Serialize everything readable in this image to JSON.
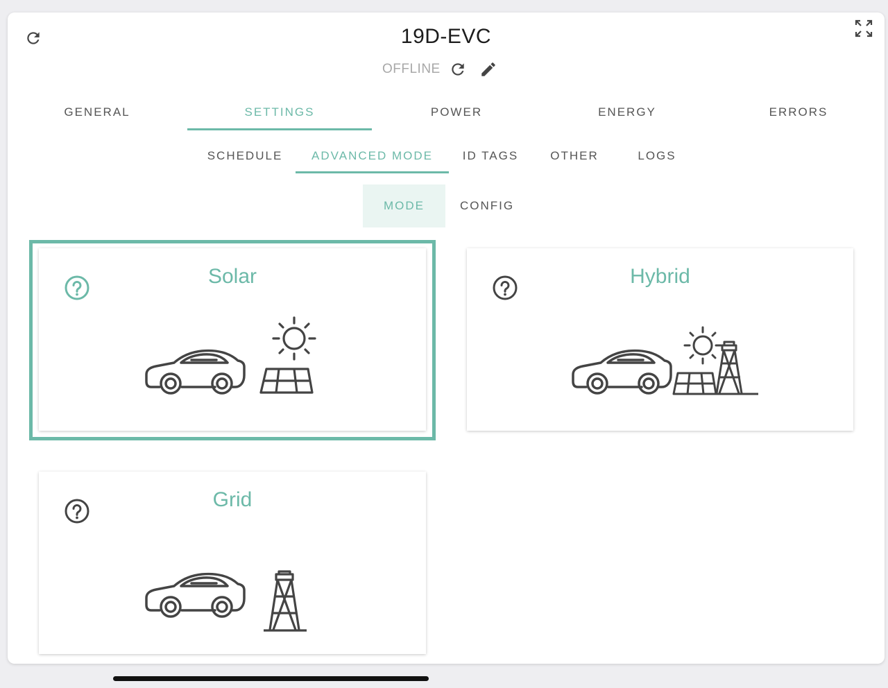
{
  "header": {
    "title": "19D-EVC",
    "status": "OFFLINE"
  },
  "tabs": [
    "GENERAL",
    "SETTINGS",
    "POWER",
    "ENERGY",
    "ERRORS"
  ],
  "active_tab": "SETTINGS",
  "subtabs": [
    "SCHEDULE",
    "ADVANCED MODE",
    "ID TAGS",
    "OTHER",
    "LOGS"
  ],
  "active_subtab": "ADVANCED MODE",
  "segments": [
    "MODE",
    "CONFIG"
  ],
  "active_segment": "MODE",
  "modes": [
    {
      "title": "Solar",
      "selected": true,
      "icons": [
        "help-icon",
        "car-icon",
        "sun-icon",
        "solar-panel-icon"
      ]
    },
    {
      "title": "Hybrid",
      "selected": false,
      "icons": [
        "help-icon",
        "car-icon",
        "sun-icon",
        "solar-panel-icon",
        "power-tower-icon"
      ]
    },
    {
      "title": "Grid",
      "selected": false,
      "icons": [
        "help-icon",
        "car-icon",
        "power-tower-icon"
      ]
    }
  ],
  "colors": {
    "accent": "#6cb9a8",
    "icon": "#444444",
    "muted": "#a8a8a8"
  }
}
